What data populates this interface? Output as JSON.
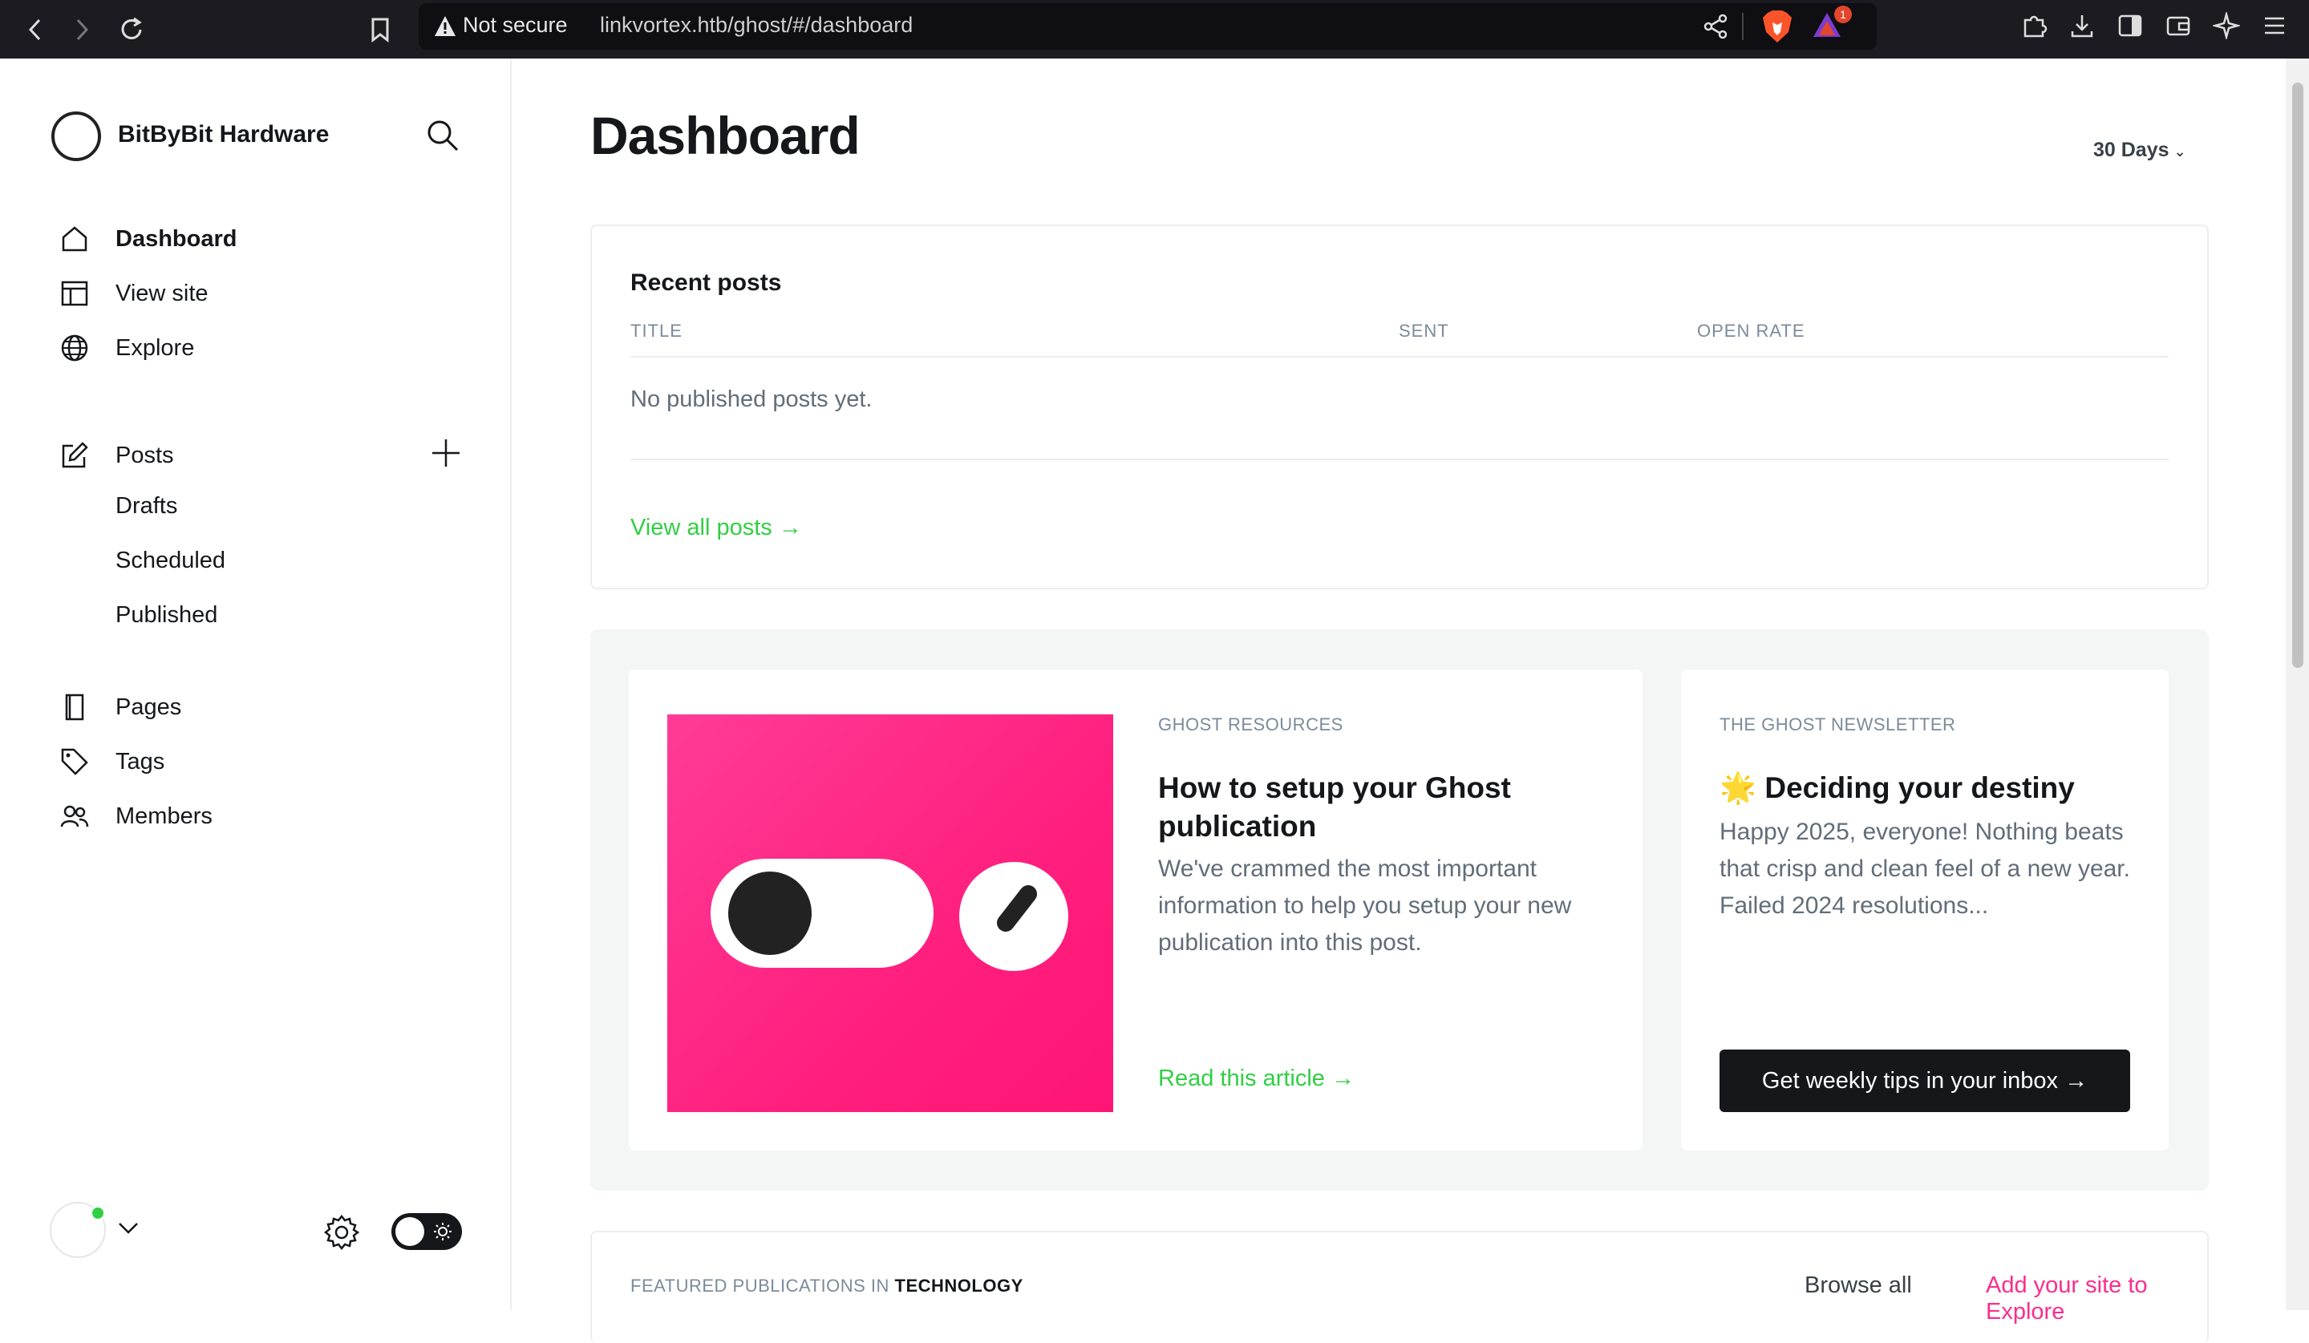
{
  "browser": {
    "security_label": "Not secure",
    "url": "linkvortex.htb/ghost/#/dashboard",
    "rewards_badge": "1"
  },
  "sidebar": {
    "site_title": "BitByBit Hardware",
    "nav": [
      {
        "label": "Dashboard",
        "icon": "home-icon"
      },
      {
        "label": "View site",
        "icon": "layout-icon"
      },
      {
        "label": "Explore",
        "icon": "globe-icon"
      },
      {
        "label": "Posts",
        "icon": "edit-icon"
      },
      {
        "label": "Pages",
        "icon": "page-icon"
      },
      {
        "label": "Tags",
        "icon": "tag-icon"
      },
      {
        "label": "Members",
        "icon": "members-icon"
      }
    ],
    "post_subitems": [
      "Drafts",
      "Scheduled",
      "Published"
    ]
  },
  "main": {
    "title": "Dashboard",
    "range": "30 Days",
    "recent_posts": {
      "title": "Recent posts",
      "columns": [
        "TITLE",
        "SENT",
        "OPEN RATE"
      ],
      "empty": "No published posts yet.",
      "view_all": "View all posts →"
    },
    "resources": {
      "eyebrow": "GHOST RESOURCES",
      "headline": "How to setup your Ghost publication",
      "body": "We've crammed the most important information to help you setup your new publication into this post.",
      "link": "Read this article →"
    },
    "newsletter": {
      "eyebrow": "THE GHOST NEWSLETTER",
      "headline": "🌟 Deciding your destiny",
      "body": "Happy 2025, everyone! Nothing beats that crisp and clean feel of a new year. Failed 2024 resolutions...",
      "button": "Get weekly tips in your inbox →"
    },
    "featured": {
      "label_prefix": "FEATURED PUBLICATIONS IN",
      "label_topic": "TECHNOLOGY",
      "browse": "Browse all",
      "add": "Add your site to Explore"
    }
  },
  "colors": {
    "accent_green": "#30cf43",
    "accent_pink": "#fb2d8d",
    "dark": "#15171a"
  }
}
